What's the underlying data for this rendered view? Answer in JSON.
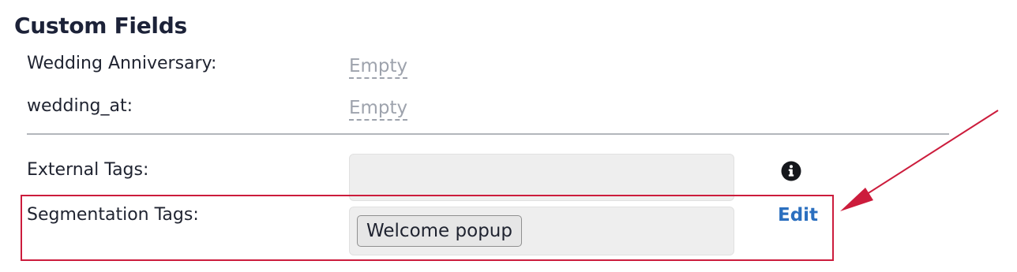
{
  "section": {
    "title": "Custom Fields"
  },
  "fields": {
    "wedding_anniversary": {
      "label": "Wedding Anniversary:",
      "value": "Empty"
    },
    "wedding_at": {
      "label": "wedding_at:",
      "value": "Empty"
    },
    "external_tags": {
      "label": "External Tags:",
      "info_icon": "info-circle-icon"
    },
    "segmentation_tags": {
      "label": "Segmentation Tags:",
      "tags": [
        "Welcome popup"
      ],
      "edit_label": "Edit"
    }
  },
  "colors": {
    "highlight": "#cc1c3c",
    "link": "#2b6fbf",
    "empty_value": "#9ea3ad"
  }
}
